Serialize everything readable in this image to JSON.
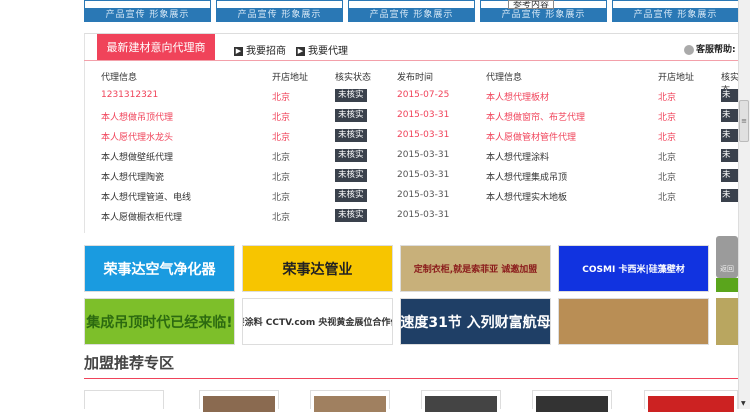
{
  "top_cards": [
    {
      "label": "产品宣传 形象展示"
    },
    {
      "label": "产品宣传 形象展示"
    },
    {
      "label": "产品宣传 形象展示"
    },
    {
      "label": "产品宣传 形象展示"
    },
    {
      "label": "产品宣传 形象展示"
    }
  ],
  "tooltip": "参考内容",
  "panel": {
    "tab": "最新建材意向代理商",
    "links": [
      "我要招商",
      "我要代理"
    ],
    "help": "客服帮助:",
    "headers": [
      "代理信息",
      "开店地址",
      "核实状态",
      "发布时间"
    ],
    "left_rows": [
      {
        "info": "1231312321",
        "addr": "北京",
        "status": "未核实",
        "date": "2015-07-25",
        "hot": true
      },
      {
        "info": "本人想做吊顶代理",
        "addr": "北京",
        "status": "未核实",
        "date": "2015-03-31",
        "hot": true
      },
      {
        "info": "本人愿代理水龙头",
        "addr": "北京",
        "status": "未核实",
        "date": "2015-03-31",
        "hot": true
      },
      {
        "info": "本人想做壁纸代理",
        "addr": "北京",
        "status": "未核实",
        "date": "2015-03-31",
        "hot": false
      },
      {
        "info": "本人想代理陶瓷",
        "addr": "北京",
        "status": "未核实",
        "date": "2015-03-31",
        "hot": false
      },
      {
        "info": "本人想代理管道、电线",
        "addr": "北京",
        "status": "未核实",
        "date": "2015-03-31",
        "hot": false
      },
      {
        "info": "本人愿做橱衣柜代理",
        "addr": "北京",
        "status": "未核实",
        "date": "2015-03-31",
        "hot": false
      }
    ],
    "right_rows": [
      {
        "info": "本人想代理板材",
        "addr": "北京",
        "status": "未核",
        "hot": true
      },
      {
        "info": "本人想做窗帘、布艺代理",
        "addr": "北京",
        "status": "未核",
        "hot": true
      },
      {
        "info": "本人愿做管材管件代理",
        "addr": "北京",
        "status": "未核",
        "hot": true
      },
      {
        "info": "本人想代理涂料",
        "addr": "北京",
        "status": "未核",
        "hot": false
      },
      {
        "info": "本人想代理集成吊顶",
        "addr": "北京",
        "status": "未核",
        "hot": false
      },
      {
        "info": "本人想代理实木地板",
        "addr": "北京",
        "status": "未核",
        "hot": false
      }
    ]
  },
  "banners": [
    {
      "text": "荣事达空气净化器",
      "bg": "#1a9be0",
      "fg": "#ffffff"
    },
    {
      "text": "荣事达管业",
      "bg": "#f7c500",
      "fg": "#222222"
    },
    {
      "text": "定制衣柜,就是索菲亚 诚邀加盟",
      "bg": "#c8b07a",
      "fg": "#8b1c1c"
    },
    {
      "text": "COSMI 卡西米|硅藻壁材",
      "bg": "#1133e0",
      "fg": "#ffffff"
    },
    {
      "text": "集成吊顶时代已经来临!",
      "bg": "#7dbf2a",
      "fg": "#2c6a10"
    },
    {
      "text": "油漆涂料 CCTV.com 央视黄金展位合作伙伴",
      "bg": "#ffffff",
      "fg": "#333333"
    },
    {
      "text": "速度31节 入列财富航母",
      "bg": "#1f3f66",
      "fg": "#ffffff"
    },
    {
      "text": "",
      "bg": "#b98e55",
      "fg": "#ffffff"
    }
  ],
  "section_title": "加盟推荐专区",
  "back_top": "返回"
}
